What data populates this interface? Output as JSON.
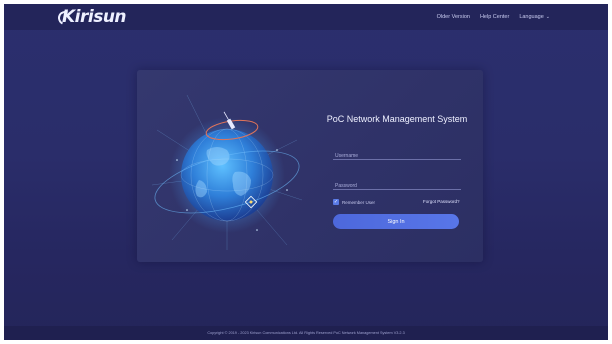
{
  "header": {
    "logo_text": "Kirisun",
    "nav": {
      "older_version": "Older Version",
      "help_center": "Help Center",
      "language": "Language"
    }
  },
  "login": {
    "title": "PoC Network Management System",
    "username_placeholder": "Username",
    "password_placeholder": "Password",
    "remember_label": "Remember User",
    "remember_checked": true,
    "forgot_label": "Forgot Password?",
    "signin_label": "Sign In"
  },
  "footer": {
    "copyright": "Copyright © 2019 - 2023 Kirisun Communications Ltd. All Rights Reserved PoC Network Management System V3.2.3"
  },
  "colors": {
    "background": "#2a2d6a",
    "card": "#32366d",
    "accent": "#5876e8",
    "globe": "#3a8fe0"
  }
}
